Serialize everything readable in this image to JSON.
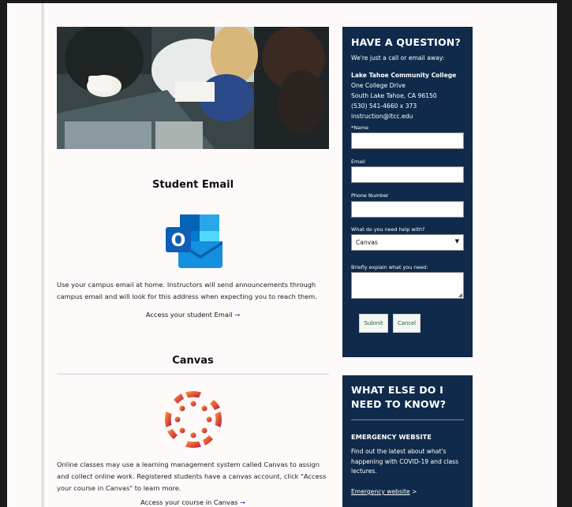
{
  "main": {
    "email": {
      "title": "Student Email",
      "description": "Use your campus email at home. Instructors will send announcements through campus email and will look for this address when expecting you to reach them.",
      "access_label": "Access your student Email",
      "arrow": "→"
    },
    "canvas": {
      "title": "Canvas",
      "description": "Online classes may use a learning management system called Canvas to assign and collect online work. Registered students have a canvas account, click \"Access your course in Canvas\" to learn more.",
      "access_label": "Access your course in Canvas",
      "arrow": "→"
    }
  },
  "contact": {
    "heading": "HAVE A QUESTION?",
    "intro": "We're just a call or email away:",
    "college": "Lake Tahoe Community College",
    "address1": "One College Drive",
    "address2": "South Lake Tahoe, CA 96150",
    "phone": "(530) 541-4660 x 373",
    "email": "instruction@ltcc.edu",
    "form": {
      "name_label": "*Name",
      "email_label": "Email",
      "phone_label": "Phone Number",
      "help_label": "What do you need help with?",
      "help_value": "Canvas",
      "explain_label": "Briefly explain what you need:",
      "submit": "Submit",
      "cancel": "Cancel"
    }
  },
  "know": {
    "heading_line1": "WHAT ELSE DO I",
    "heading_line2": "NEED TO KNOW?",
    "emergency_title": "EMERGENCY WEBSITE",
    "emergency_text": "Find out the latest about what's happening with COVID-19 and class lectures.",
    "emergency_link": "Emergency website",
    "emergency_link_arrow": ">"
  },
  "colors": {
    "sidebar_bg": "#0f2a4a",
    "page_bg": "#fffafa",
    "outlook_blue": "#0f6cbd",
    "canvas_red": "#e0523b"
  }
}
